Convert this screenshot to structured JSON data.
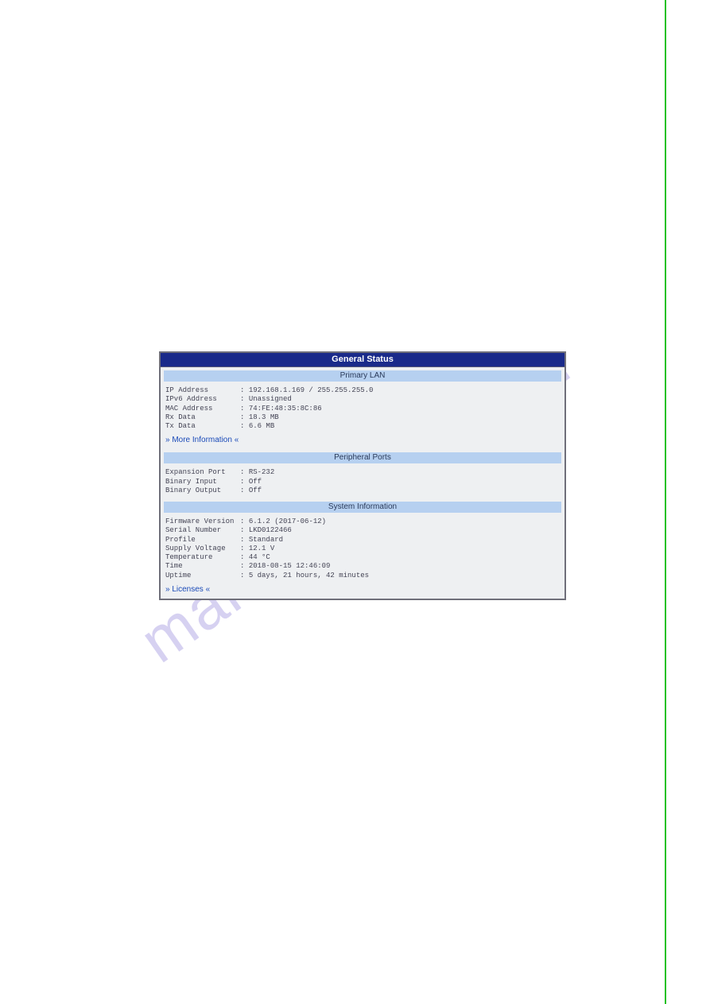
{
  "watermark": "manualshive.com",
  "panel": {
    "title": "General Status",
    "sections": {
      "primary_lan": {
        "header": "Primary LAN",
        "rows": [
          {
            "label": "IP Address",
            "value": "192.168.1.169 / 255.255.255.0"
          },
          {
            "label": "IPv6 Address",
            "value": "Unassigned"
          },
          {
            "label": "MAC Address",
            "value": "74:FE:48:35:8C:86"
          },
          {
            "label": "Rx Data",
            "value": "18.3 MB"
          },
          {
            "label": "Tx Data",
            "value": "6.6 MB"
          }
        ],
        "link": "» More Information «"
      },
      "peripheral_ports": {
        "header": "Peripheral Ports",
        "rows": [
          {
            "label": "Expansion Port",
            "value": "RS-232"
          },
          {
            "label": "Binary Input",
            "value": "Off"
          },
          {
            "label": "Binary Output",
            "value": "Off"
          }
        ]
      },
      "system_information": {
        "header": "System Information",
        "rows": [
          {
            "label": "Firmware Version",
            "value": "6.1.2 (2017-06-12)"
          },
          {
            "label": "Serial Number",
            "value": "LKD0122466"
          },
          {
            "label": "Profile",
            "value": "Standard"
          },
          {
            "label": "Supply Voltage",
            "value": "12.1 V"
          },
          {
            "label": "Temperature",
            "value": "44 °C"
          },
          {
            "label": "Time",
            "value": "2018-08-15 12:46:09"
          },
          {
            "label": "Uptime",
            "value": "5 days, 21 hours, 42 minutes"
          }
        ],
        "link": "» Licenses «"
      }
    }
  }
}
